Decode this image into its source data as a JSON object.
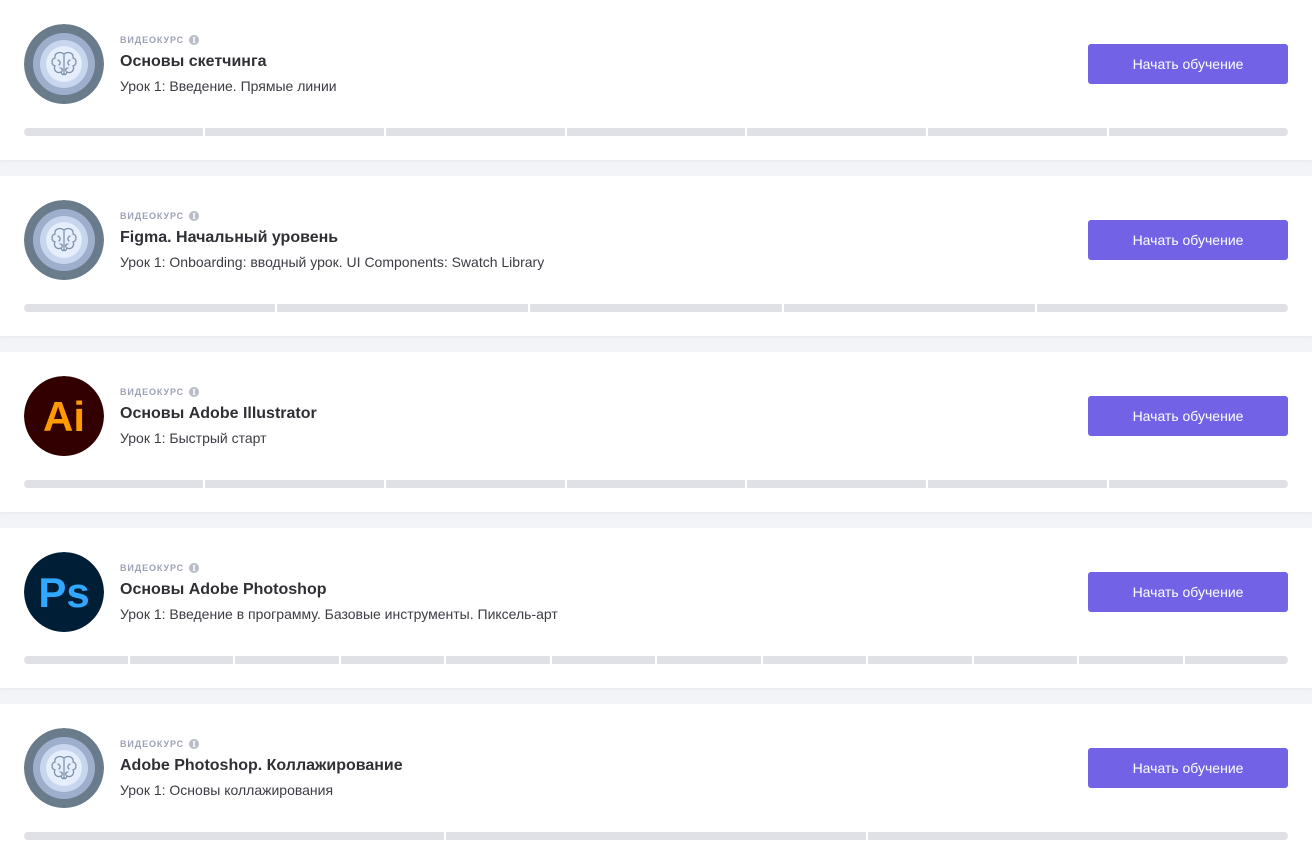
{
  "courses": [
    {
      "kind": "Видеокурс",
      "title": "Основы скетчинга",
      "lesson": "Урок 1: Введение. Прямые линии",
      "icon": "brain-icon",
      "button": "Начать обучение",
      "progress": {
        "segments": 7,
        "completed": 0
      }
    },
    {
      "kind": "Видеокурс",
      "title": "Figma. Начальный уровень",
      "lesson": "Урок 1: Onboarding: вводный урок. UI Components: Swatch Library",
      "icon": "brain-icon",
      "button": "Начать обучение",
      "progress": {
        "segments": 5,
        "completed": 0
      }
    },
    {
      "kind": "Видеокурс",
      "title": "Основы Adobe Illustrator",
      "lesson": "Урок 1: Быстрый старт",
      "icon": "adobe-illustrator-icon",
      "icon_text": "Ai",
      "button": "Начать обучение",
      "progress": {
        "segments": 7,
        "completed": 0
      }
    },
    {
      "kind": "Видеокурс",
      "title": "Основы Adobe Photoshop",
      "lesson": "Урок 1: Введение в программу. Базовые инструменты. Пиксель-арт",
      "icon": "adobe-photoshop-icon",
      "icon_text": "Ps",
      "button": "Начать обучение",
      "progress": {
        "segments": 12,
        "completed": 0
      }
    },
    {
      "kind": "Видеокурс",
      "title": "Adobe Photoshop. Коллажирование",
      "lesson": "Урок 1: Основы коллажирования",
      "icon": "brain-icon",
      "button": "Начать обучение",
      "progress": {
        "segments": 3,
        "completed": 0
      }
    }
  ],
  "colors": {
    "accent": "#7263e6",
    "progress_empty": "#dfe1e6",
    "illustrator_bg": "#330000",
    "illustrator_fg": "#ff9a00",
    "photoshop_bg": "#001e36",
    "photoshop_fg": "#31a8ff",
    "brain_ring_outer": "#6a7c8b",
    "brain_ring_mid": "#9dafcc",
    "brain_ring_inner": "#c7d6ec",
    "brain_core": "#e5eefa"
  }
}
